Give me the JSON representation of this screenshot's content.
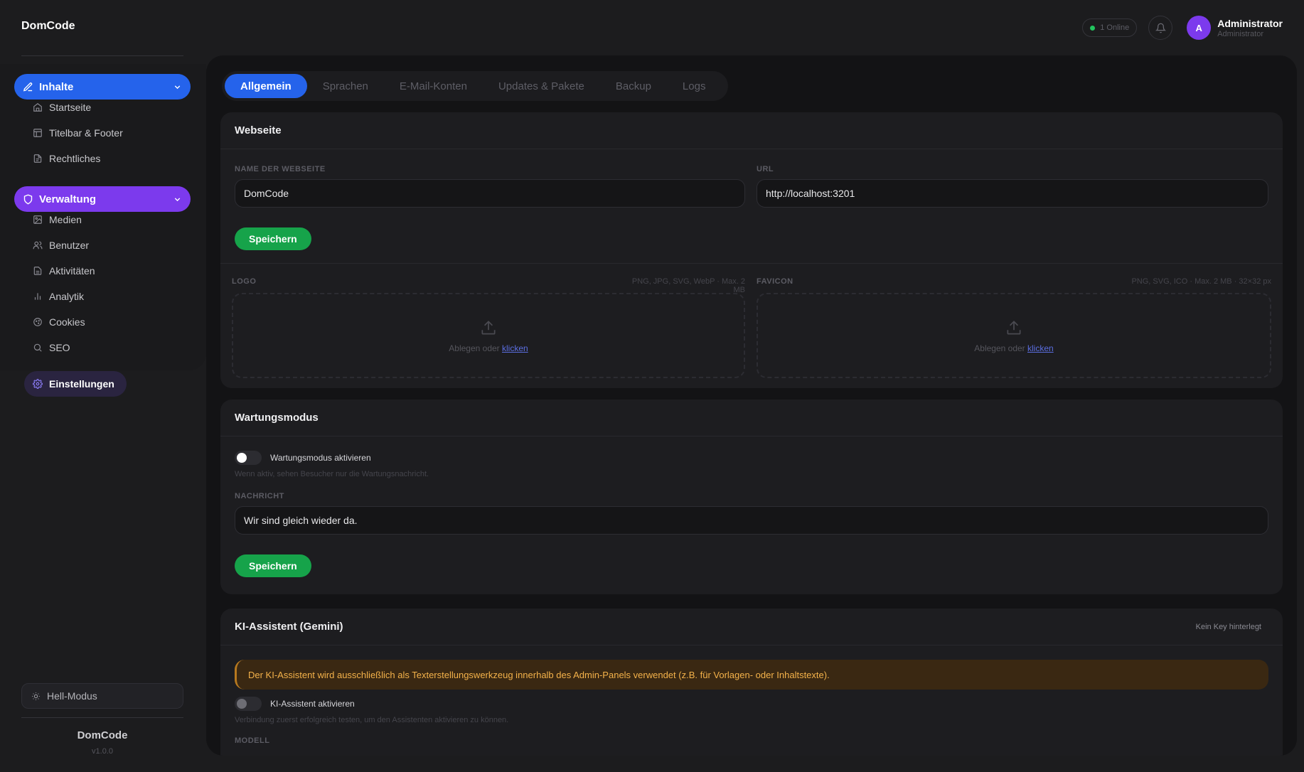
{
  "app": {
    "brand": "DomCode",
    "online": "1 Online",
    "user": {
      "initial": "A",
      "name": "Administrator",
      "role": "Administrator"
    }
  },
  "sidebar": {
    "groups": [
      {
        "label": "Inhalte",
        "items": [
          "Startseite",
          "Titelbar & Footer",
          "Rechtliches"
        ]
      },
      {
        "label": "Verwaltung",
        "items": [
          "Medien",
          "Benutzer",
          "Aktivitäten",
          "Analytik",
          "Cookies",
          "SEO",
          "Einstellungen"
        ]
      }
    ],
    "active": "Einstellungen",
    "light_mode": "Hell-Modus",
    "footer_brand": "DomCode",
    "version": "v1.0.0"
  },
  "tabs": [
    "Allgemein",
    "Sprachen",
    "E-Mail-Konten",
    "Updates & Pakete",
    "Backup",
    "Logs"
  ],
  "active_tab": "Allgemein",
  "webseite": {
    "title": "Webseite",
    "name_label": "NAME DER WEBSEITE",
    "name_value": "DomCode",
    "url_label": "URL",
    "url_value": "http://localhost:3201",
    "save": "Speichern",
    "logo_label": "LOGO",
    "logo_hint": "PNG, JPG, SVG, WebP · Max. 2 MB",
    "favicon_label": "FAVICON",
    "favicon_hint": "PNG, SVG, ICO · Max. 2 MB · 32×32 px",
    "drop_text": "Ablegen oder",
    "drop_link": "klicken"
  },
  "wartung": {
    "title": "Wartungsmodus",
    "toggle_label": "Wartungsmodus aktivieren",
    "toggle_hint": "Wenn aktiv, sehen Besucher nur die Wartungsnachricht.",
    "message_label": "NACHRICHT",
    "message_value": "Wir sind gleich wieder da.",
    "save": "Speichern"
  },
  "ki": {
    "title": "KI-Assistent (Gemini)",
    "badge": "Kein Key hinterlegt",
    "warning": "Der KI-Assistent wird ausschließlich als Texterstellungswerkzeug innerhalb des Admin-Panels verwendet (z.B. für Vorlagen- oder Inhaltstexte).",
    "toggle_label": "KI-Assistent aktivieren",
    "toggle_hint": "Verbindung zuerst erfolgreich testen, um den Assistenten aktivieren zu können.",
    "model_label": "MODELL"
  },
  "colors": {
    "blue": "#2563eb",
    "purple": "#7c3aed",
    "green": "#16a34a",
    "warning": "#f4b24a"
  }
}
